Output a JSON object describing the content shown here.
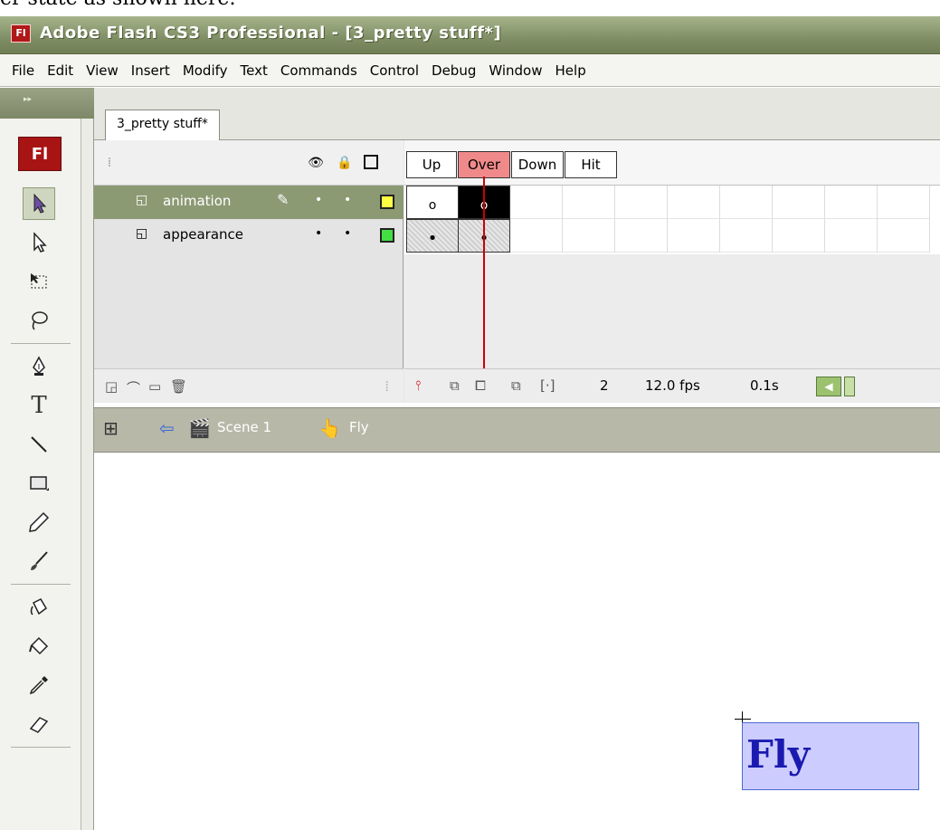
{
  "caption": "er state as shown here.",
  "window": {
    "logo": "Fl",
    "title": "Adobe Flash CS3 Professional - [3_pretty stuff*]"
  },
  "menu": [
    "File",
    "Edit",
    "View",
    "Insert",
    "Modify",
    "Text",
    "Commands",
    "Control",
    "Debug",
    "Window",
    "Help"
  ],
  "toolbar": {
    "logo": "Fl",
    "grip": "▸▸",
    "tools": [
      {
        "name": "selection-tool",
        "icon": "arrow-icon",
        "selected": true
      },
      {
        "name": "subselection-tool",
        "icon": "hollow-arrow-icon",
        "selected": false
      },
      {
        "name": "free-transform-tool",
        "icon": "transform-icon",
        "selected": false
      },
      {
        "name": "lasso-tool",
        "icon": "lasso-icon",
        "selected": false
      },
      {
        "name": "pen-tool",
        "icon": "pen-icon",
        "selected": false
      },
      {
        "name": "text-tool",
        "icon": "text-icon",
        "selected": false
      },
      {
        "name": "line-tool",
        "icon": "line-icon",
        "selected": false
      },
      {
        "name": "rectangle-tool",
        "icon": "rectangle-icon",
        "selected": false
      },
      {
        "name": "pencil-tool",
        "icon": "pencil-icon",
        "selected": false
      },
      {
        "name": "brush-tool",
        "icon": "brush-icon",
        "selected": false
      },
      {
        "name": "ink-bottle-tool",
        "icon": "ink-bottle-icon",
        "selected": false
      },
      {
        "name": "paint-bucket-tool",
        "icon": "paint-bucket-icon",
        "selected": false
      },
      {
        "name": "eyedropper-tool",
        "icon": "eyedropper-icon",
        "selected": false
      },
      {
        "name": "eraser-tool",
        "icon": "eraser-icon",
        "selected": false
      }
    ],
    "text_glyph": "T"
  },
  "document": {
    "tab": "3_pretty stuff*"
  },
  "timeline": {
    "frame_labels": [
      "Up",
      "Over",
      "Down",
      "Hit"
    ],
    "current_frame_label": "Over",
    "layers": [
      {
        "name": "animation",
        "selected": true,
        "color": "#ffff44",
        "keyframes": [
          "o",
          "o"
        ]
      },
      {
        "name": "appearance",
        "selected": false,
        "color": "#44dd44",
        "keyframes": [
          "•",
          "•"
        ]
      }
    ],
    "status": {
      "frame": "2",
      "fps": "12.0 fps",
      "time": "0.1s"
    }
  },
  "editbar": {
    "scene": "Scene 1",
    "symbol": "Fly"
  },
  "stage": {
    "button_text": "Fly",
    "button_fill": "#ccccff",
    "button_text_color": "#1a1ab0"
  }
}
